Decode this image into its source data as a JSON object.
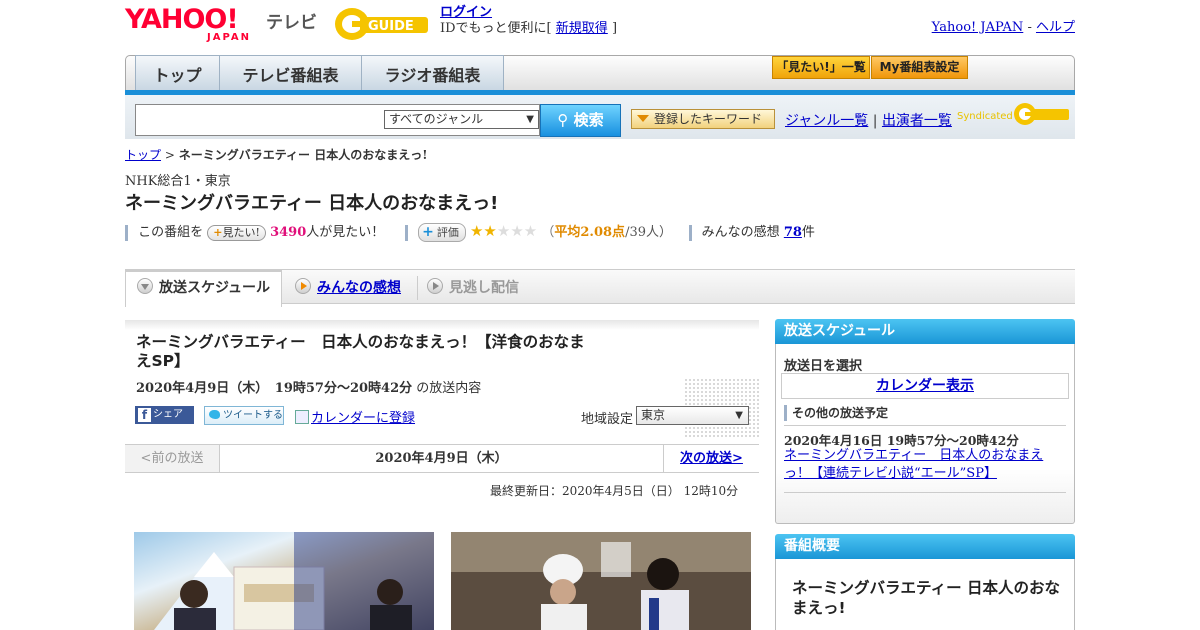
{
  "header": {
    "yahoo_logo": "YAHOO!",
    "yahoo_japan": "JAPAN",
    "tv_label": "テレビ",
    "gguide_logo": "G-GUIDE",
    "login": "ログイン",
    "login_sub_prefix": "IDでもっと便利に[",
    "register": "新規取得",
    "login_sub_suffix": "]",
    "yahoo_japan_link": "Yahoo! JAPAN",
    "separator": "-",
    "help_link": "ヘルプ"
  },
  "nav": {
    "tabs": [
      "トップ",
      "テレビ番組表",
      "ラジオ番組表"
    ],
    "mitai_list": "「見たい!」一覧",
    "my_bangumi": "My番組表設定"
  },
  "search": {
    "placeholder": "",
    "genre_selected": "すべてのジャンル",
    "button": "検索",
    "keyword_button": "登録したキーワード",
    "genre_list": "ジャンル一覧",
    "divider": "|",
    "performer_list": "出演者一覧",
    "syndicated": "Syndicated"
  },
  "breadcrumb": {
    "top": "トップ",
    "sep": ">",
    "current": "ネーミングバラエティー 日本人のおなまえっ!"
  },
  "program": {
    "channel": "NHK総合1・東京",
    "title": "ネーミングバラエティー 日本人のおなまえっ!",
    "mitai_prefix": "この番組を",
    "mitai_badge": "見たい!",
    "mitai_count": "3490",
    "mitai_suffix": "人が見たい！",
    "hyoka_badge": "評価",
    "rating_open": "（",
    "avg_label": "平均2.08点",
    "rating_count": "/39人）",
    "rating_stars_filled": 2,
    "rating_stars_total": 5,
    "kanso_prefix": "みんなの感想",
    "kanso_count": "78",
    "kanso_suffix": "件"
  },
  "content_tabs": {
    "schedule": "放送スケジュール",
    "reviews": "みんなの感想",
    "streaming": "見逃し配信"
  },
  "episode": {
    "title": "ネーミングバラエティー　日本人のおなまえっ！【洋食のおなまえSP】",
    "date": "2020年4月9日（木）　19時57分～20時42分",
    "date_suffix": "の放送内容",
    "share_fb": "シェア",
    "share_tw": "ツイートする",
    "calendar_register": "カレンダーに登録",
    "region_label": "地域設定",
    "region_selected": "東京",
    "prev": "<前の放送",
    "current_date": "2020年4月9日（木）",
    "next": "次の放送>",
    "updated": "最終更新日：2020年4月5日（日）  12時10分"
  },
  "sidebar": {
    "schedule_head": "放送スケジュール",
    "select_date": "放送日を選択",
    "calendar_show": "カレンダー表示",
    "other_schedule": "その他の放送予定",
    "other_date": "2020年4月16日  19時57分～20時42分",
    "other_link": "ネーミングバラエティー　日本人のおなまえっ！【連続テレビ小説“エール”SP】",
    "summary_head": "番組概要",
    "summary_title": "ネーミングバラエティー 日本人のおなまえっ!"
  },
  "colors": {
    "accent_blue": "#1a8fd8",
    "yahoo_red": "#ff0033",
    "rating_orange": "#e08a00",
    "count_pink": "#e0107a"
  }
}
